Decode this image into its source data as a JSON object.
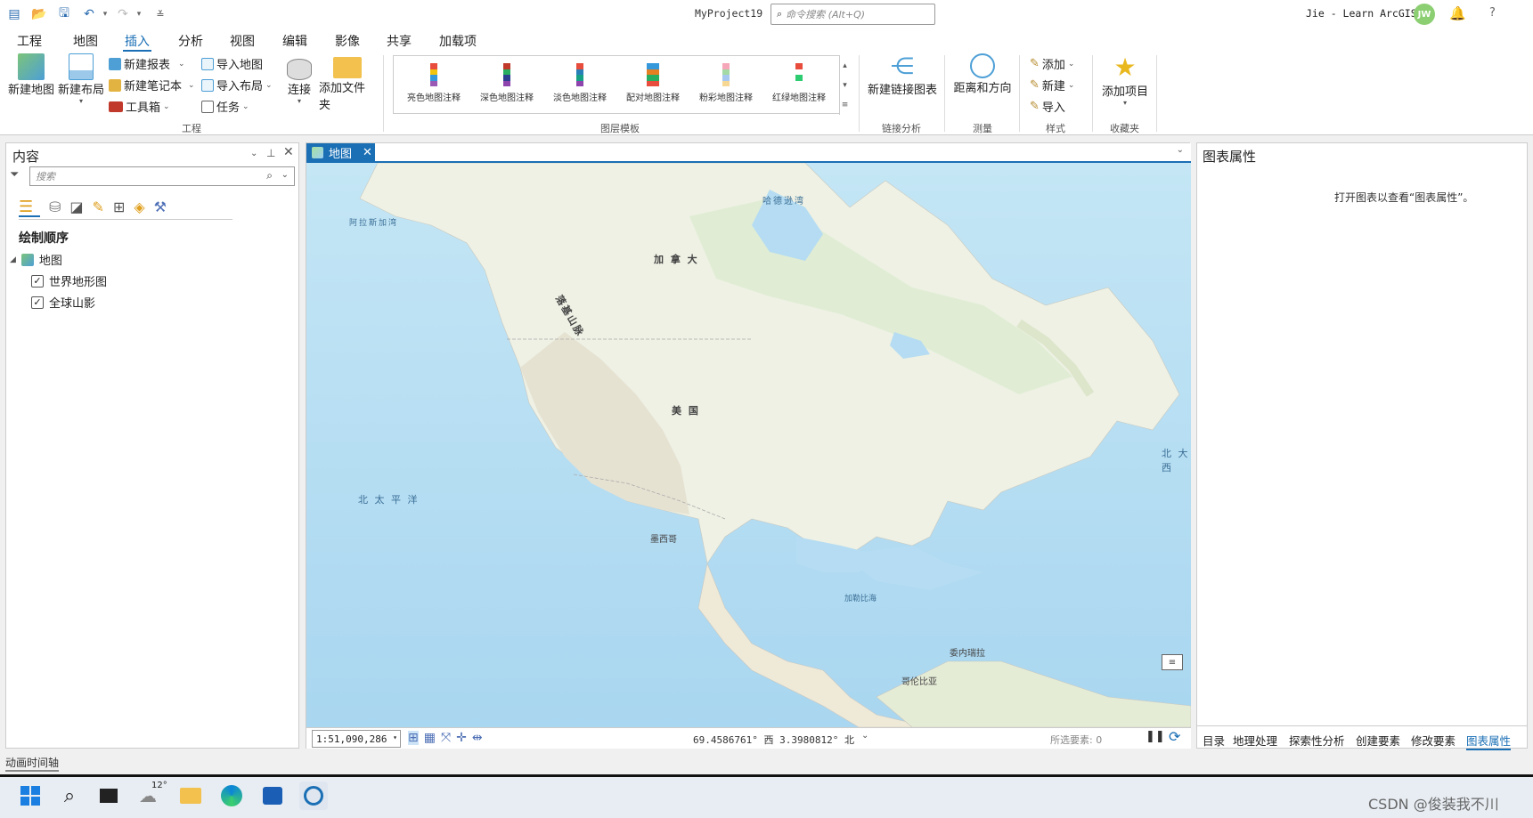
{
  "titlebar": {
    "project": "MyProject19",
    "search_placeholder": "命令搜索 (Alt+Q)",
    "user": "Jie - Learn ArcGIS",
    "avatar": "JW",
    "help": "?"
  },
  "menu": [
    "工程",
    "地图",
    "插入",
    "分析",
    "视图",
    "编辑",
    "影像",
    "共享",
    "加载项"
  ],
  "menu_active": "插入",
  "ribbon": {
    "new_map": "新建地图",
    "new_layout": "新建布局",
    "new_report": "新建报表",
    "new_notebook": "新建笔记本",
    "toolbox": "工具箱",
    "import_map": "导入地图",
    "import_layout": "导入布局",
    "task": "任务",
    "connect": "连接",
    "add_folder": "添加文件夹",
    "group_project": "工程",
    "gallery": [
      "亮色地图注释",
      "深色地图注释",
      "淡色地图注释",
      "配对地图注释",
      "粉彩地图注释",
      "红绿地图注释"
    ],
    "group_gallery": "图层模板",
    "new_link_chart": "新建链接图表",
    "group_link": "链接分析",
    "distance_direction": "距离和方向",
    "group_measure": "测量",
    "style_add": "添加",
    "style_new": "新建",
    "style_import": "导入",
    "group_style": "样式",
    "add_item": "添加项目",
    "group_fav": "收藏夹"
  },
  "contents": {
    "title": "内容",
    "search_placeholder": "搜索",
    "draw_order": "绘制顺序",
    "map_name": "地图",
    "layers": [
      {
        "name": "世界地形图",
        "checked": true
      },
      {
        "name": "全球山影",
        "checked": true
      }
    ]
  },
  "map": {
    "tab": "地图",
    "labels": {
      "hudson": "哈德逊湾",
      "alaska": "阿拉斯加湾",
      "canada": "加 拿 大",
      "rocky": "落基山脉",
      "usa": "美 国",
      "pacific": "北 太 平 洋",
      "atlantic": "北 大 西",
      "mexico": "墨西哥",
      "caribbean": "加勒比海",
      "venezuela": "委内瑞拉",
      "colombia": "哥伦比亚"
    },
    "scale": "1:51,090,286",
    "coords": "69.4586761° 西  3.3980812° 北",
    "selected": "所选要素: 0"
  },
  "chart_props": {
    "title": "图表属性",
    "message": "打开图表以查看“图表属性”。"
  },
  "bottom_tabs": [
    "目录",
    "地理处理",
    "探索性分析",
    "创建要素",
    "修改要素",
    "图表属性"
  ],
  "bottom_tab_active": "图表属性",
  "statusbar": {
    "timeline": "动画时间轴"
  },
  "taskbar": {
    "weather_temp": "12°",
    "watermark": "CSDN @俊装我不川"
  }
}
